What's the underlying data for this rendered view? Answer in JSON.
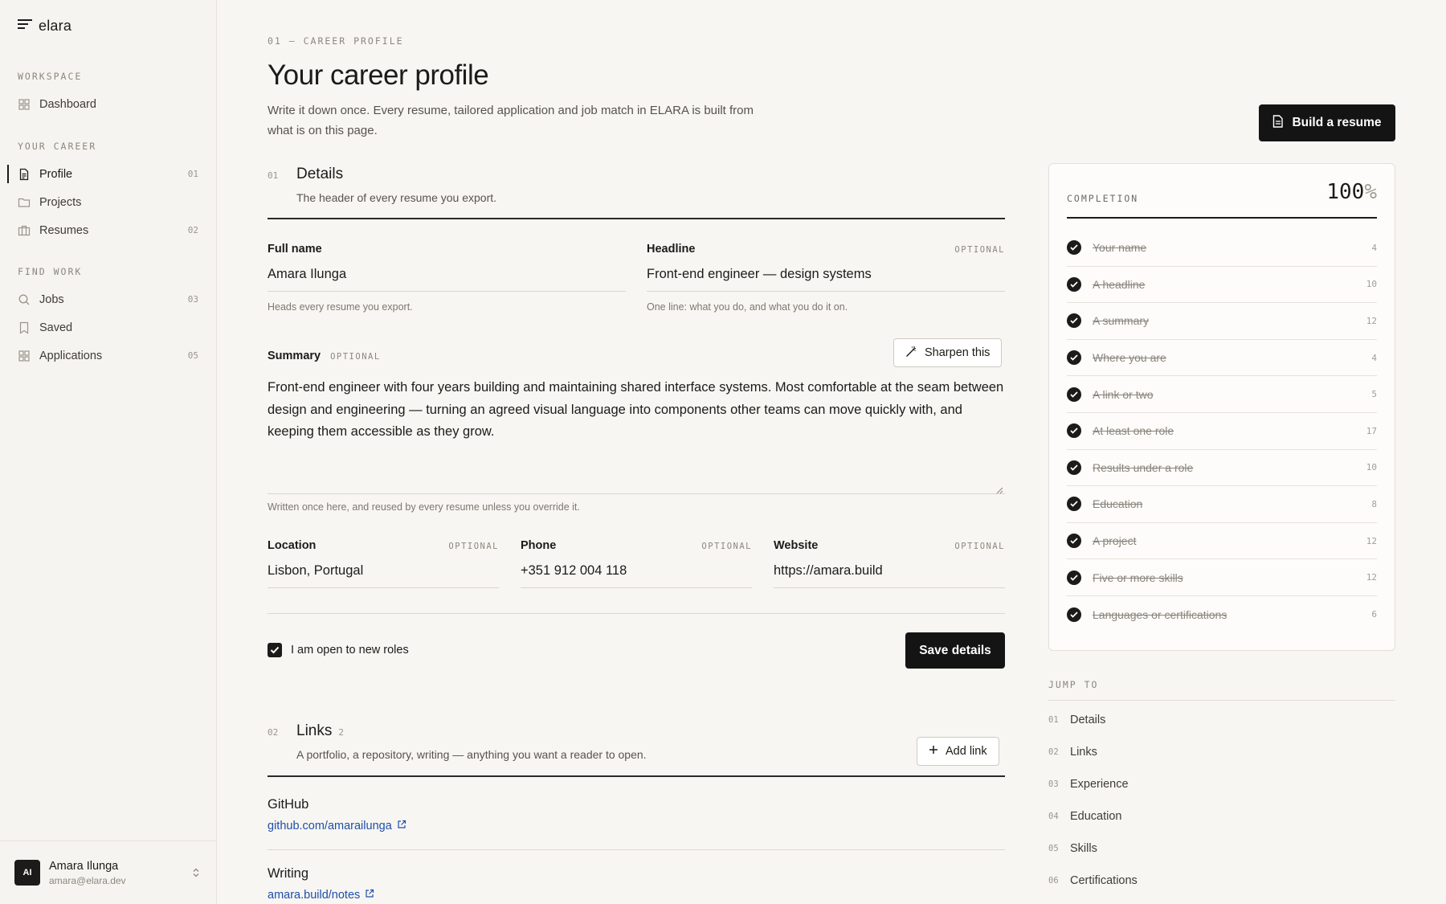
{
  "brand": {
    "name": "elara"
  },
  "sidebar": {
    "sections": [
      {
        "heading": "WORKSPACE",
        "items": [
          {
            "label": "Dashboard",
            "icon": "dashboard-icon",
            "count": ""
          }
        ]
      },
      {
        "heading": "YOUR CAREER",
        "items": [
          {
            "label": "Profile",
            "icon": "document-icon",
            "count": "01",
            "active": true
          },
          {
            "label": "Projects",
            "icon": "folder-icon",
            "count": ""
          },
          {
            "label": "Resumes",
            "icon": "briefcase-icon",
            "count": "02"
          }
        ]
      },
      {
        "heading": "FIND WORK",
        "items": [
          {
            "label": "Jobs",
            "icon": "search-icon",
            "count": "03"
          },
          {
            "label": "Saved",
            "icon": "bookmark-icon",
            "count": ""
          },
          {
            "label": "Applications",
            "icon": "dashboard-icon",
            "count": "05"
          }
        ]
      }
    ],
    "user": {
      "initials": "AI",
      "name": "Amara Ilunga",
      "email": "amara@elara.dev"
    }
  },
  "page": {
    "eyebrow": "01 — CAREER PROFILE",
    "title": "Your career profile",
    "subtitle": "Write it down once. Every resume, tailored application and job match in ELARA is built from what is on this page.",
    "build_button": "Build a resume"
  },
  "details": {
    "num": "01",
    "title": "Details",
    "desc": "The header of every resume you export.",
    "full_name": {
      "label": "Full name",
      "value": "Amara Ilunga",
      "hint": "Heads every resume you export."
    },
    "headline": {
      "label": "Headline",
      "optional": "OPTIONAL",
      "value": "Front-end engineer — design systems",
      "hint": "One line: what you do, and what you do it on."
    },
    "summary": {
      "label": "Summary",
      "optional": "OPTIONAL",
      "sharpen_label": "Sharpen this",
      "value": "Front-end engineer with four years building and maintaining shared interface systems. Most comfortable at the seam between design and engineering — turning an agreed visual language into components other teams can move quickly with, and keeping them accessible as they grow.",
      "hint": "Written once here, and reused by every resume unless you override it."
    },
    "location": {
      "label": "Location",
      "optional": "OPTIONAL",
      "value": "Lisbon, Portugal"
    },
    "phone": {
      "label": "Phone",
      "optional": "OPTIONAL",
      "value": "+351 912 004 118"
    },
    "website": {
      "label": "Website",
      "optional": "OPTIONAL",
      "value": "https://amara.build"
    },
    "open_to_roles": {
      "label": "I am open to new roles",
      "checked": true
    },
    "save_label": "Save details"
  },
  "links": {
    "num": "02",
    "title": "Links",
    "count": "2",
    "desc": "A portfolio, a repository, writing — anything you want a reader to open.",
    "add_label": "Add link",
    "items": [
      {
        "title": "GitHub",
        "url": "github.com/amarailunga"
      },
      {
        "title": "Writing",
        "url": "amara.build/notes"
      }
    ]
  },
  "completion": {
    "label": "COMPLETION",
    "percent": "100",
    "percent_symbol": "%",
    "items": [
      {
        "label": "Your name",
        "points": "4"
      },
      {
        "label": "A headline",
        "points": "10"
      },
      {
        "label": "A summary",
        "points": "12"
      },
      {
        "label": "Where you are",
        "points": "4"
      },
      {
        "label": "A link or two",
        "points": "5"
      },
      {
        "label": "At least one role",
        "points": "17"
      },
      {
        "label": "Results under a role",
        "points": "10"
      },
      {
        "label": "Education",
        "points": "8"
      },
      {
        "label": "A project",
        "points": "12"
      },
      {
        "label": "Five or more skills",
        "points": "12"
      },
      {
        "label": "Languages or certifications",
        "points": "6"
      }
    ]
  },
  "jump_to": {
    "heading": "JUMP TO",
    "items": [
      {
        "num": "01",
        "label": "Details"
      },
      {
        "num": "02",
        "label": "Links"
      },
      {
        "num": "03",
        "label": "Experience"
      },
      {
        "num": "04",
        "label": "Education"
      },
      {
        "num": "05",
        "label": "Skills"
      },
      {
        "num": "06",
        "label": "Certifications"
      }
    ]
  },
  "colors": {
    "accent": "#141414",
    "background": "#f8f6f3",
    "link": "#1d4fa8"
  }
}
